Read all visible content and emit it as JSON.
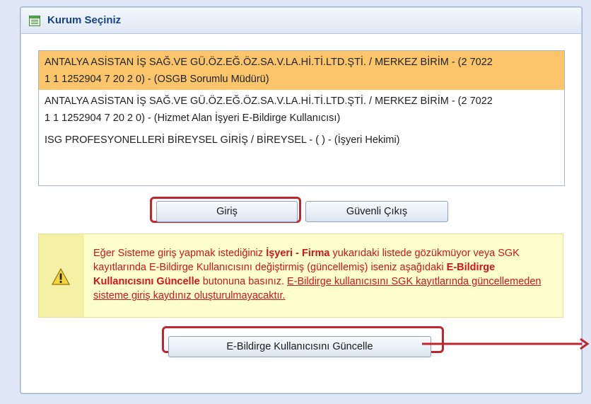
{
  "panel": {
    "title": "Kurum Seçiniz"
  },
  "list": {
    "items": [
      {
        "line1": "ANTALYA ASİSTAN İŞ SAĞ.VE GÜ.ÖZ.EĞ.ÖZ.SA.V.LA.Hİ.Tİ.LTD.ŞTİ. / MERKEZ BİRİM - (2 7022",
        "line2": "1 1 1252904 7 20 2 0) - (OSGB Sorumlu Müdürü)",
        "selected": true
      },
      {
        "line1": "ANTALYA ASİSTAN İŞ SAĞ.VE GÜ.ÖZ.EĞ.ÖZ.SA.V.LA.Hİ.Tİ.LTD.ŞTİ. / MERKEZ BİRİM - (2 7022",
        "line2": "1 1 1252904 7 20 2 0) - (Hizmet Alan İşyeri E-Bildirge Kullanıcısı)",
        "selected": false
      },
      {
        "line1": "ISG PROFESYONELLERİ BİREYSEL GİRİŞ / BİREYSEL - ( ) - (İşyeri Hekimi)",
        "line2": "",
        "selected": false
      }
    ]
  },
  "buttons": {
    "login_label": "Giriş",
    "logout_label": "Güvenli Çıkış",
    "update_label": "E-Bildirge Kullanıcısını Güncelle"
  },
  "warning": {
    "t1": "Eğer Sisteme giriş yapmak istediğiniz ",
    "b1": "İşyeri - Firma",
    "t2": " yukarıdaki listede gözükmüyor veya SGK kayıtlarında E-Bildirge Kullanıcısını değiştirmiş (güncellemiş) iseniz aşağıdaki ",
    "b2": "E-Bildirge Kullanıcısını Güncelle",
    "t3": " butonuna basınız. ",
    "u1": "E-Bildirge kullanıcısını SGK kayıtlarında güncellemeden sisteme giriş kaydınız oluşturulmayacaktır."
  },
  "colors": {
    "selected_row": "#fbc66b",
    "warning_text": "#d3121f",
    "highlight_border": "#c0262e",
    "header_text": "#15428b"
  },
  "icons": {
    "header": "list-icon",
    "warning": "warning-triangle-icon"
  }
}
